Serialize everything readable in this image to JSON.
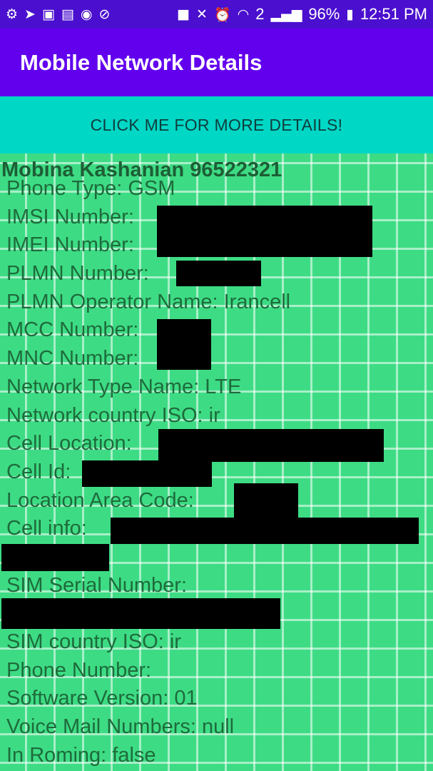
{
  "status_bar": {
    "left_icons": [
      "settings-icon",
      "send-icon",
      "gallery-icon",
      "carrier-icon",
      "vpn-icon",
      "mute-icon"
    ],
    "right_icons": [
      "lock-icon",
      "mute-icon",
      "alarm-icon",
      "wifi-icon",
      "sim-icon",
      "signal-icon",
      "battery-icon"
    ],
    "sim_badge": "2",
    "battery": "96%",
    "time": "12:51 PM"
  },
  "app_bar": {
    "title": "Mobile Network Details"
  },
  "details_button": {
    "label": "CLICK ME FOR MORE DETAILS!"
  },
  "content": {
    "header": "Mobina Kashanian 96522321",
    "rows": [
      "Phone Type: GSM",
      "IMSI Number:",
      "IMEI Number:",
      "PLMN Number:",
      "PLMN Operator Name: Irancell",
      "MCC Number:",
      "MNC Number:",
      "Network Type Name: LTE",
      "Network country ISO: ir",
      "Cell Location:",
      "Cell Id:",
      "Location Area Code:",
      "Cell info:",
      "",
      "SIM Serial Number:",
      "",
      "SIM country ISO: ir",
      "Phone Number:",
      "Software Version: 01",
      "Voice Mail Numbers: null",
      "In Roming: false"
    ]
  },
  "colors": {
    "status_bar": "#4a0fcf",
    "app_bar": "#6200ee",
    "button": "#00d7c5",
    "background": "#3ddc84",
    "text": "#1e6b3c"
  }
}
